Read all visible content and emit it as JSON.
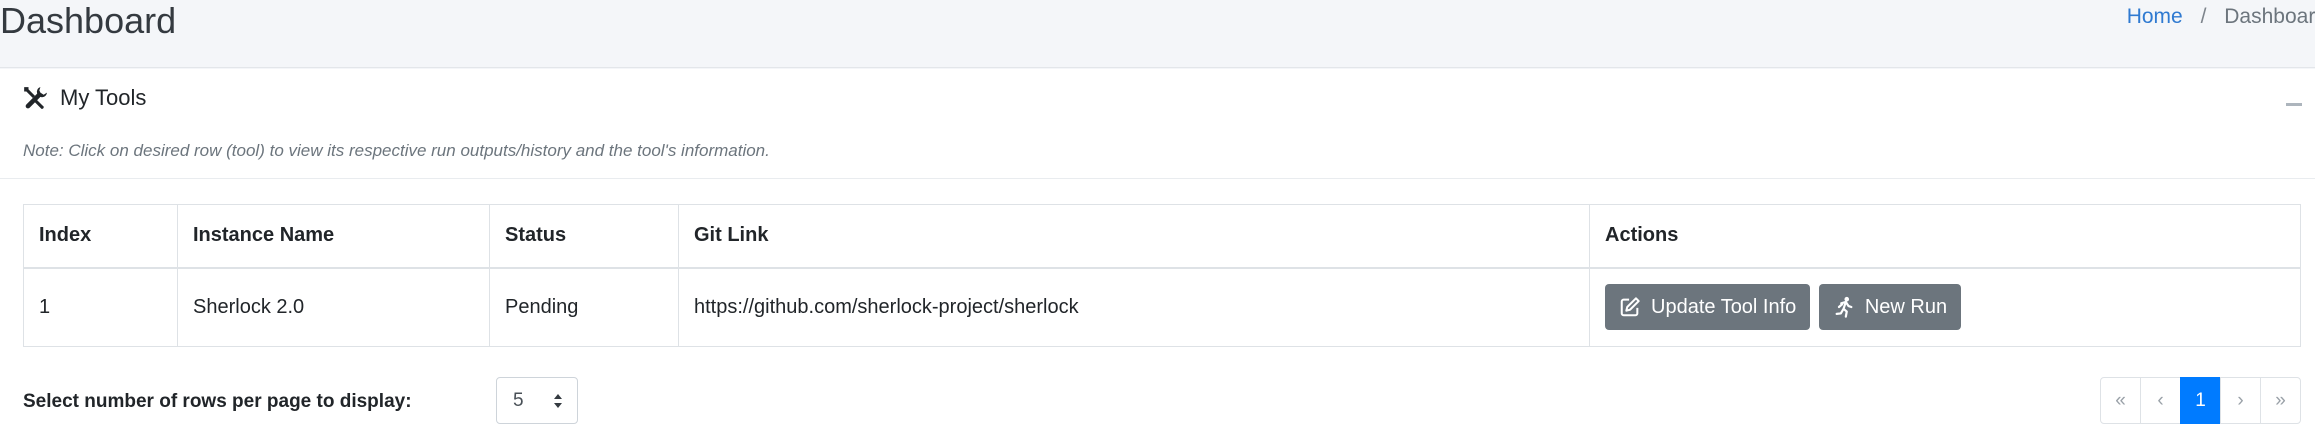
{
  "header": {
    "title": "Dashboard",
    "breadcrumb": {
      "home": "Home",
      "separator": "/",
      "current": "Dashboard"
    }
  },
  "card": {
    "title": "My Tools",
    "note": "Note: Click on desired row (tool) to view its respective run outputs/history and the tool's information."
  },
  "table": {
    "columns": [
      "Index",
      "Instance Name",
      "Status",
      "Git Link",
      "Actions"
    ],
    "rows": [
      {
        "index": "1",
        "name": "Sherlock 2.0",
        "status": "Pending",
        "git": "https://github.com/sherlock-project/sherlock",
        "actions": {
          "update": "Update Tool Info",
          "run": "New Run"
        }
      }
    ]
  },
  "footer": {
    "rows_label": "Select number of rows per page to display:",
    "rows_value": "5",
    "pagination": {
      "first": "«",
      "prev": "‹",
      "current": "1",
      "next": "›",
      "last": "»"
    }
  },
  "colors": {
    "primary": "#007bff",
    "button": "#6c757d",
    "link": "#2f7ad1"
  },
  "icons": [
    "tools-icon",
    "minus-icon",
    "edit-icon",
    "running-icon",
    "sort-arrows-icon"
  ]
}
